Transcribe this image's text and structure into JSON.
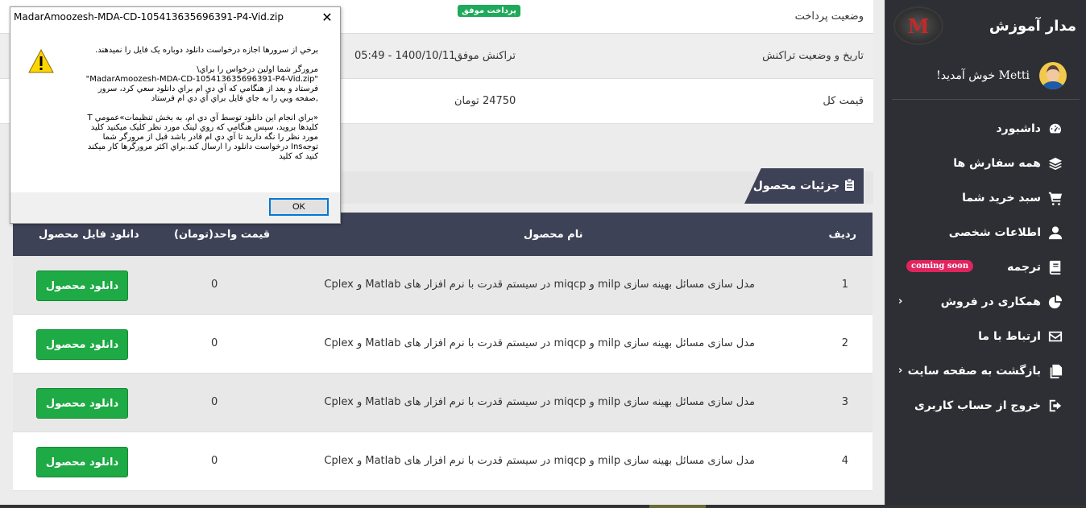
{
  "dialog": {
    "title": "MadarAmoozesh-MDA-CD-105413635696391-P4-Vid.zip",
    "close": "✕",
    "message": "برخي از سرورها اجازه درخواست دانلود دوباره يک فايل را نميدهند.\n\nمرورگر شما اولين درخواس را براي\\\n\"MadarAmoozesh-MDA-CD-105413635696391-P4-Vid.zip\"\nفرستاد و بعد از هنگامي که آي دي ام براي دانلود سعي کرد، سرور\n,صفحه وبي را به جاي فايل براي آي دي ام فرستاد\n\n«براي انجام اين دانلود توسط آي دي ام، به بخش تنظيمات»عمومي T\nکليدها برويد، سپس هنگامي که روي لينک مورد نظر کليک ميکنيد کليد\nمورد نظر را نگه داريد تا آي دي ام قادر باشد قبل از مرورگر شما\nتوجهIns درخواست دانلود را ارسال کند.براي اکثر مرورگرها کار ميکند\nکنيد که کليد",
    "ok": "OK"
  },
  "info": {
    "rows": [
      {
        "label": "وضعیت پرداخت",
        "badge": "پرداخت موفق"
      },
      {
        "label": "تاریخ و وضعیت تراکنش",
        "status": "تراکنش موفق",
        "datetime": "1400/10/11 - 05:49"
      },
      {
        "label": "قیمت کل",
        "value": "24750 تومان"
      }
    ]
  },
  "section": {
    "title": "جزئیات محصول"
  },
  "table": {
    "headers": {
      "row": "ردیف",
      "name": "نام محصول",
      "price": "قیمت واحد(تومان)",
      "download": "دانلود فایل محصول"
    },
    "rows": [
      {
        "num": "1",
        "name": "مدل سازی مسائل بهینه سازی milp و miqcp در سیستم قدرت با نرم افزار های Matlab و Cplex",
        "price": "0",
        "button": "دانلود محصول"
      },
      {
        "num": "2",
        "name": "مدل سازی مسائل بهینه سازی milp و miqcp در سیستم قدرت با نرم افزار های Matlab و Cplex",
        "price": "0",
        "button": "دانلود محصول"
      },
      {
        "num": "3",
        "name": "مدل سازی مسائل بهینه سازی milp و miqcp در سیستم قدرت با نرم افزار های Matlab و Cplex",
        "price": "0",
        "button": "دانلود محصول"
      },
      {
        "num": "4",
        "name": "مدل سازی مسائل بهینه سازی milp و miqcp در سیستم قدرت با نرم افزار های Matlab و Cplex",
        "price": "0",
        "button": "دانلود محصول"
      }
    ]
  },
  "sidebar": {
    "brand": "مدار آموزش",
    "logo_letter": "M",
    "welcome": "Metti خوش آمدید!",
    "items": [
      {
        "label": "داشبورد",
        "icon": "dashboard-icon"
      },
      {
        "label": "همه سفارش ها",
        "icon": "layers-icon"
      },
      {
        "label": "سبد خرید شما",
        "icon": "cart-icon"
      },
      {
        "label": "اطلاعات شخصی",
        "icon": "user-icon"
      },
      {
        "label": "ترجمه",
        "icon": "book-icon",
        "badge": "coming soon"
      },
      {
        "label": "همکاری در فروش",
        "icon": "pie-chart-icon",
        "chevron": "‹"
      },
      {
        "label": "ارتباط با ما",
        "icon": "envelope-icon"
      },
      {
        "label": "بازگشت به صفحه سایت",
        "icon": "copy-icon",
        "chevron": "‹"
      },
      {
        "label": "خروج از حساب کاربری",
        "icon": "sign-out-icon"
      }
    ]
  },
  "colors": {
    "sidebar_bg": "#2d2f34",
    "header_bg": "#3e4257",
    "success": "#1eaa44",
    "badge_pink": "#e0245e"
  }
}
